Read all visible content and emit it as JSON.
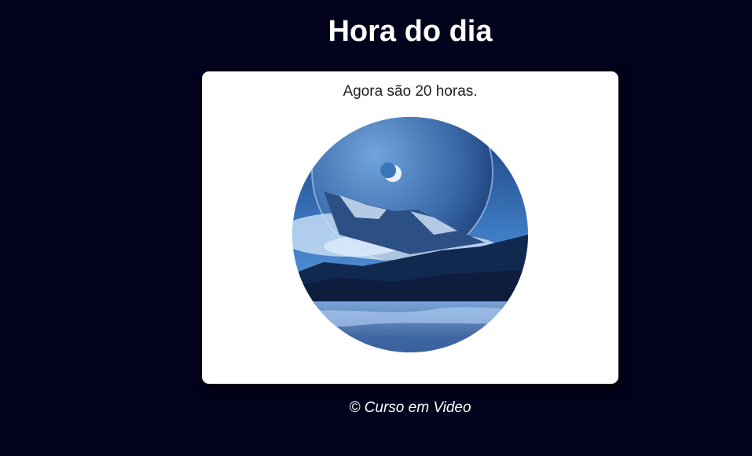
{
  "page": {
    "title": "Hora do dia",
    "background_color": "#02021c"
  },
  "card": {
    "message": "Agora são 20 horas.",
    "image": {
      "scene": "night",
      "icon": "night-landscape-image"
    }
  },
  "footer": {
    "text": "© Curso em Video"
  }
}
